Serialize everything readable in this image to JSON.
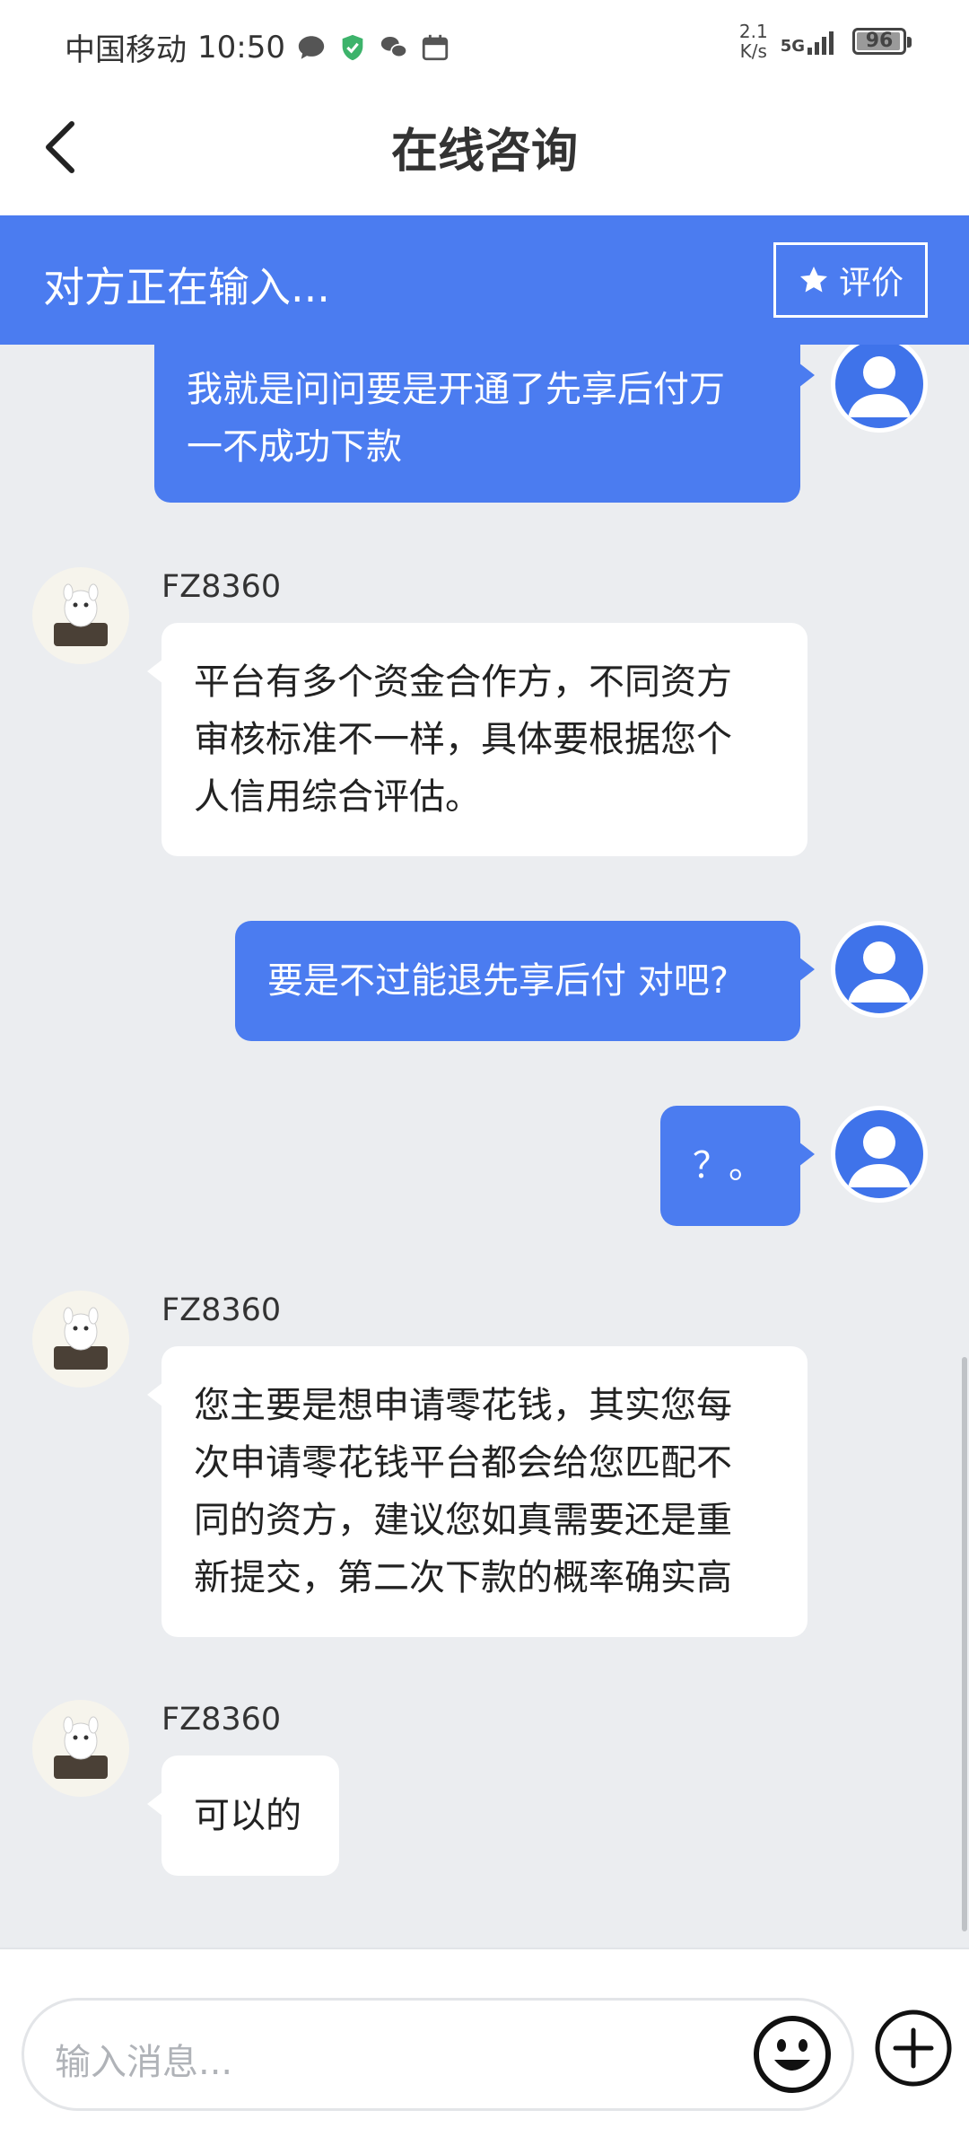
{
  "status_bar": {
    "carrier": "中国移动",
    "time": "10:50",
    "net_speed_value": "2.1",
    "net_speed_unit": "K/s",
    "network": "5G",
    "battery": "96",
    "battery_level": 0.96
  },
  "header": {
    "title": "在线咨询"
  },
  "banner": {
    "typing_text": "对方正在输入...",
    "rate_label": "评价"
  },
  "messages": [
    {
      "from": "user",
      "lines": [
        "我就是问问要是开通了先享后付万",
        "一不成功下款"
      ]
    },
    {
      "from": "agent",
      "name": "FZ8360",
      "lines": [
        "平台有多个资金合作方，不同资方",
        "审核标准不一样，具体要根据您个",
        "人信用综合评估。"
      ]
    },
    {
      "from": "user",
      "lines": [
        "要是不过能退先享后付 对吧?"
      ]
    },
    {
      "from": "user",
      "lines": [
        "？。"
      ]
    },
    {
      "from": "agent",
      "name": "FZ8360",
      "lines": [
        "您主要是想申请零花钱，其实您每",
        "次申请零花钱平台都会给您匹配不",
        "同的资方，建议您如真需要还是重",
        "新提交，第二次下款的概率确实高"
      ]
    },
    {
      "from": "agent",
      "name": "FZ8360",
      "lines": [
        "可以的"
      ]
    }
  ],
  "input": {
    "placeholder": "输入消息..."
  },
  "icons": {
    "back": "chevron-left-icon",
    "rate": "star-icon",
    "emoji": "smiley-icon",
    "plus": "plus-circle-icon",
    "user_avatar": "user-avatar-icon",
    "agent_avatar": "agent-avatar-icon"
  },
  "colors": {
    "primary": "#4b7cf0",
    "chat_bg": "#ebedf0",
    "bubble_in": "#ffffff"
  }
}
